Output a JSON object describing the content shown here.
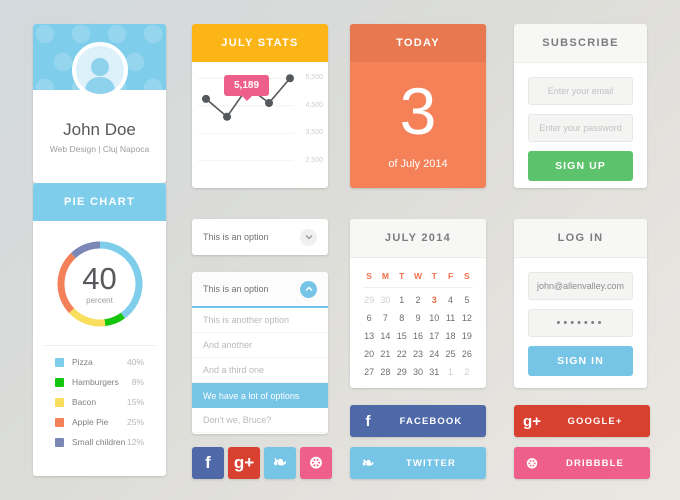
{
  "theme": {
    "blue": "#7ecdea",
    "amber": "#fbb517",
    "coral": "#f58158",
    "green": "#5dc26c",
    "pink": "#ef5f8c",
    "facebook": "#4e68a8",
    "googleplus": "#d8412f",
    "twitter": "#76c5e6",
    "dribbble": "#ef5f8c"
  },
  "profile": {
    "name": "John Doe",
    "role": "Web Design | Cluj Napoca",
    "avatar_icon": "user-avatar-icon"
  },
  "pie_card": {
    "title": "PIE CHART",
    "center_value": "40",
    "center_label": "percent"
  },
  "stats_card": {
    "title": "JULY STATS",
    "tooltip": "5,189"
  },
  "today_card": {
    "title": "TODAY",
    "day": "3",
    "subtitle": "of July 2014"
  },
  "subscribe_card": {
    "title": "SUBSCRIBE",
    "email_placeholder": "Enter your email",
    "email_value": "",
    "password_placeholder": "Enter your password",
    "password_value": "",
    "button_label": "SIGN UP"
  },
  "login_card": {
    "title": "LOG IN",
    "email_value": "john@allenvalley.com",
    "password_value": "•••••••",
    "button_label": "SIGN IN"
  },
  "dropdown_closed": {
    "selected": "This is an option",
    "icon": "chevron-down-icon"
  },
  "dropdown_open": {
    "selected": "This is an option",
    "icon": "chevron-up-icon",
    "options": [
      "This is another option",
      "And another",
      "And a third one",
      "We have a lot of options",
      "Don't we, Bruce?"
    ],
    "highlighted_index": 3
  },
  "calendar": {
    "title": "JULY 2014",
    "weekdays": [
      "S",
      "M",
      "T",
      "W",
      "T",
      "F",
      "S"
    ],
    "weeks": [
      [
        {
          "d": "29",
          "dim": true
        },
        {
          "d": "30",
          "dim": true
        },
        {
          "d": "1"
        },
        {
          "d": "2"
        },
        {
          "d": "3",
          "today": true
        },
        {
          "d": "4"
        },
        {
          "d": "5"
        }
      ],
      [
        {
          "d": "6"
        },
        {
          "d": "7"
        },
        {
          "d": "8"
        },
        {
          "d": "9"
        },
        {
          "d": "10"
        },
        {
          "d": "11"
        },
        {
          "d": "12"
        }
      ],
      [
        {
          "d": "13"
        },
        {
          "d": "14"
        },
        {
          "d": "15"
        },
        {
          "d": "16"
        },
        {
          "d": "17"
        },
        {
          "d": "18"
        },
        {
          "d": "19"
        }
      ],
      [
        {
          "d": "20"
        },
        {
          "d": "21"
        },
        {
          "d": "22"
        },
        {
          "d": "23"
        },
        {
          "d": "24"
        },
        {
          "d": "25"
        },
        {
          "d": "26"
        }
      ],
      [
        {
          "d": "27"
        },
        {
          "d": "28"
        },
        {
          "d": "29"
        },
        {
          "d": "30"
        },
        {
          "d": "31"
        },
        {
          "d": "1",
          "dim": true
        },
        {
          "d": "2",
          "dim": true
        }
      ]
    ]
  },
  "social_squares": [
    {
      "name": "facebook",
      "glyph": "f",
      "color": "#4e68a8"
    },
    {
      "name": "googleplus",
      "glyph": "g+",
      "color": "#d8412f"
    },
    {
      "name": "twitter",
      "glyph": "❧",
      "color": "#76c5e6"
    },
    {
      "name": "dribbble",
      "glyph": "⊛",
      "color": "#ef5f8c"
    }
  ],
  "social_buttons": [
    {
      "name": "facebook",
      "label": "FACEBOOK",
      "glyph": "f"
    },
    {
      "name": "googleplus",
      "label": "GOOGLE+",
      "glyph": "g+"
    },
    {
      "name": "twitter",
      "label": "TWITTER",
      "glyph": "❧"
    },
    {
      "name": "dribbble",
      "label": "DRIBBBLE",
      "glyph": "⊛"
    }
  ],
  "chart_data": [
    {
      "type": "pie",
      "title": "PIE CHART",
      "labels": [
        "Pizza",
        "Hamburgers",
        "Bacon",
        "Apple Pie",
        "Small children"
      ],
      "values": [
        40,
        8,
        15,
        25,
        12
      ],
      "value_labels": [
        "40%",
        "8%",
        "15%",
        "25%",
        "12%"
      ],
      "colors": [
        "#7ecdea",
        "#16c60c",
        "#f9dd5c",
        "#f58158",
        "#7b88b5"
      ],
      "legend": "bottom",
      "center_value": "40",
      "center_label": "percent"
    },
    {
      "type": "line",
      "title": "JULY STATS",
      "x": [
        1,
        2,
        3,
        4,
        5
      ],
      "values": [
        4750,
        4100,
        5189,
        4600,
        5500
      ],
      "ytick_labels": [
        "5,500",
        "4,500",
        "3,500",
        "2,500"
      ],
      "yticks": [
        5500,
        4500,
        3500,
        2500
      ],
      "ylim": [
        2200,
        5800
      ],
      "annotation": "5,189",
      "annotation_index": 2,
      "line_color": "#55585c",
      "grid": true,
      "legend": "none",
      "xlabel": "",
      "ylabel": ""
    }
  ]
}
